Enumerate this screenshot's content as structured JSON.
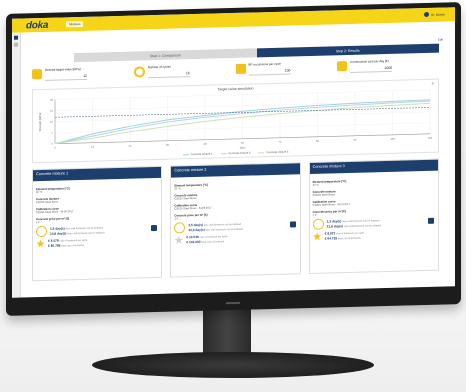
{
  "app": {
    "logo": "doka",
    "breadcrumb": "Mixtures",
    "user": "Dr. Muster",
    "settings": "Edit"
  },
  "tabs": [
    {
      "label": "Step 1: Comparison",
      "active": false
    },
    {
      "label": "Step 2: Results",
      "active": true
    }
  ],
  "kpis": [
    {
      "label": "Desired target value [MPa]",
      "value": "12",
      "icon": "formwork-icon"
    },
    {
      "label": "Number of cycles",
      "value": "16",
      "icon": "cycle-ring-icon"
    },
    {
      "label": "BP occurrence per cycle",
      "value": "100",
      "icon": "truck-icon"
    },
    {
      "label": "Construction cost per day [€]",
      "value": "1000",
      "icon": "money-icon"
    }
  ],
  "chart_data": {
    "type": "line",
    "title": "Target value simulation",
    "xlabel": "Time",
    "ylabel": "Strength [MPa]",
    "x": [
      0,
      12,
      24,
      36,
      48,
      60,
      72,
      84,
      96,
      108,
      120
    ],
    "series": [
      {
        "name": "Concrete mixture 1",
        "color": "#9fd4d9",
        "values": [
          0,
          4,
          7,
          9.5,
          11,
          12.5,
          13.5,
          14.2,
          14.8,
          15.2,
          15.5
        ]
      },
      {
        "name": "Concrete mixture 2",
        "color": "#b9d3ea",
        "values": [
          0,
          3,
          6,
          8.5,
          10.2,
          11.5,
          12.6,
          13.4,
          14,
          14.5,
          14.9
        ]
      },
      {
        "name": "Concrete mixture 3",
        "color": "#c9e3b8",
        "values": [
          0,
          2,
          4.5,
          6.5,
          8.3,
          9.8,
          11,
          12,
          12.8,
          13.4,
          13.9
        ]
      }
    ],
    "ylim": [
      0,
      20
    ],
    "grid": true,
    "legend": "bottom"
  },
  "mixtures": [
    {
      "title": "Concrete mixture 1",
      "fields": [
        {
          "label": "Element temperature [°C]",
          "value": "20 °C"
        },
        {
          "label": "Concrete mixture",
          "value": "C20/25 Steel fibres"
        },
        {
          "label": "Calibration curve",
          "value": "C20/25 Steel fibres - 34.06.2017"
        },
        {
          "label": "Concrete price per m³ [€]",
          "value": "1 €"
        }
      ],
      "results": [
        {
          "value": "1,5 day(s)",
          "note": "time until formwork can be stripped",
          "icon": "clock-icon"
        },
        {
          "value": "14,8 day(s)",
          "note": "time until formwork can be stripped",
          "icon": "calendar-icon"
        },
        {
          "value": "€ 8.478",
          "note": "cost of formwork per cycle",
          "icon": "star-icon"
        },
        {
          "value": "€ 86.788",
          "note": "total cost of formwork",
          "icon": "star-grey-icon"
        }
      ]
    },
    {
      "title": "Concrete mixture 2",
      "fields": [
        {
          "label": "Element temperature [°C]",
          "value": "20 °C"
        },
        {
          "label": "Concrete mixture",
          "value": "C20/25 Steel fibres"
        },
        {
          "label": "Calibration curve",
          "value": "C20/25 Steel fibres - 34.06.2017"
        },
        {
          "label": "Concrete price per m³ [€]",
          "value": "1 €"
        }
      ],
      "results": [
        {
          "value": "2,5 day(s)",
          "note": "time until formwork can be stripped",
          "icon": "clock-icon"
        },
        {
          "value": "32,9 day(s)",
          "note": "time until formwork can be stripped",
          "icon": "calendar-icon"
        },
        {
          "value": "€ 12.036",
          "note": "cost of formwork per cycle",
          "icon": "star-icon"
        },
        {
          "value": "€ 142.000",
          "note": "total cost of formwork",
          "icon": "star-grey-icon"
        }
      ]
    },
    {
      "title": "Concrete mixture 3",
      "fields": [
        {
          "label": "Element temperature [°C]",
          "value": "20 °C"
        },
        {
          "label": "Concrete mixture",
          "value": "C20/25 Steel fibres"
        },
        {
          "label": "Calibration curve",
          "value": "C20/25 Steel fibres - 34.06.2017"
        },
        {
          "label": "Concrete price per m³ [€]",
          "value": "1 €"
        }
      ],
      "results": [
        {
          "value": "2,3 day(s)",
          "note": "time until formwork can be stripped",
          "icon": "clock-icon"
        },
        {
          "value": "21,6 day(s)",
          "note": "time until formwork can be stripped",
          "icon": "calendar-icon"
        },
        {
          "value": "€ 8.872",
          "note": "cost of formwork per cycle",
          "icon": "star-icon"
        },
        {
          "value": "€ 64.728",
          "note": "total cost of formwork",
          "icon": "star-grey-icon"
        }
      ]
    }
  ]
}
